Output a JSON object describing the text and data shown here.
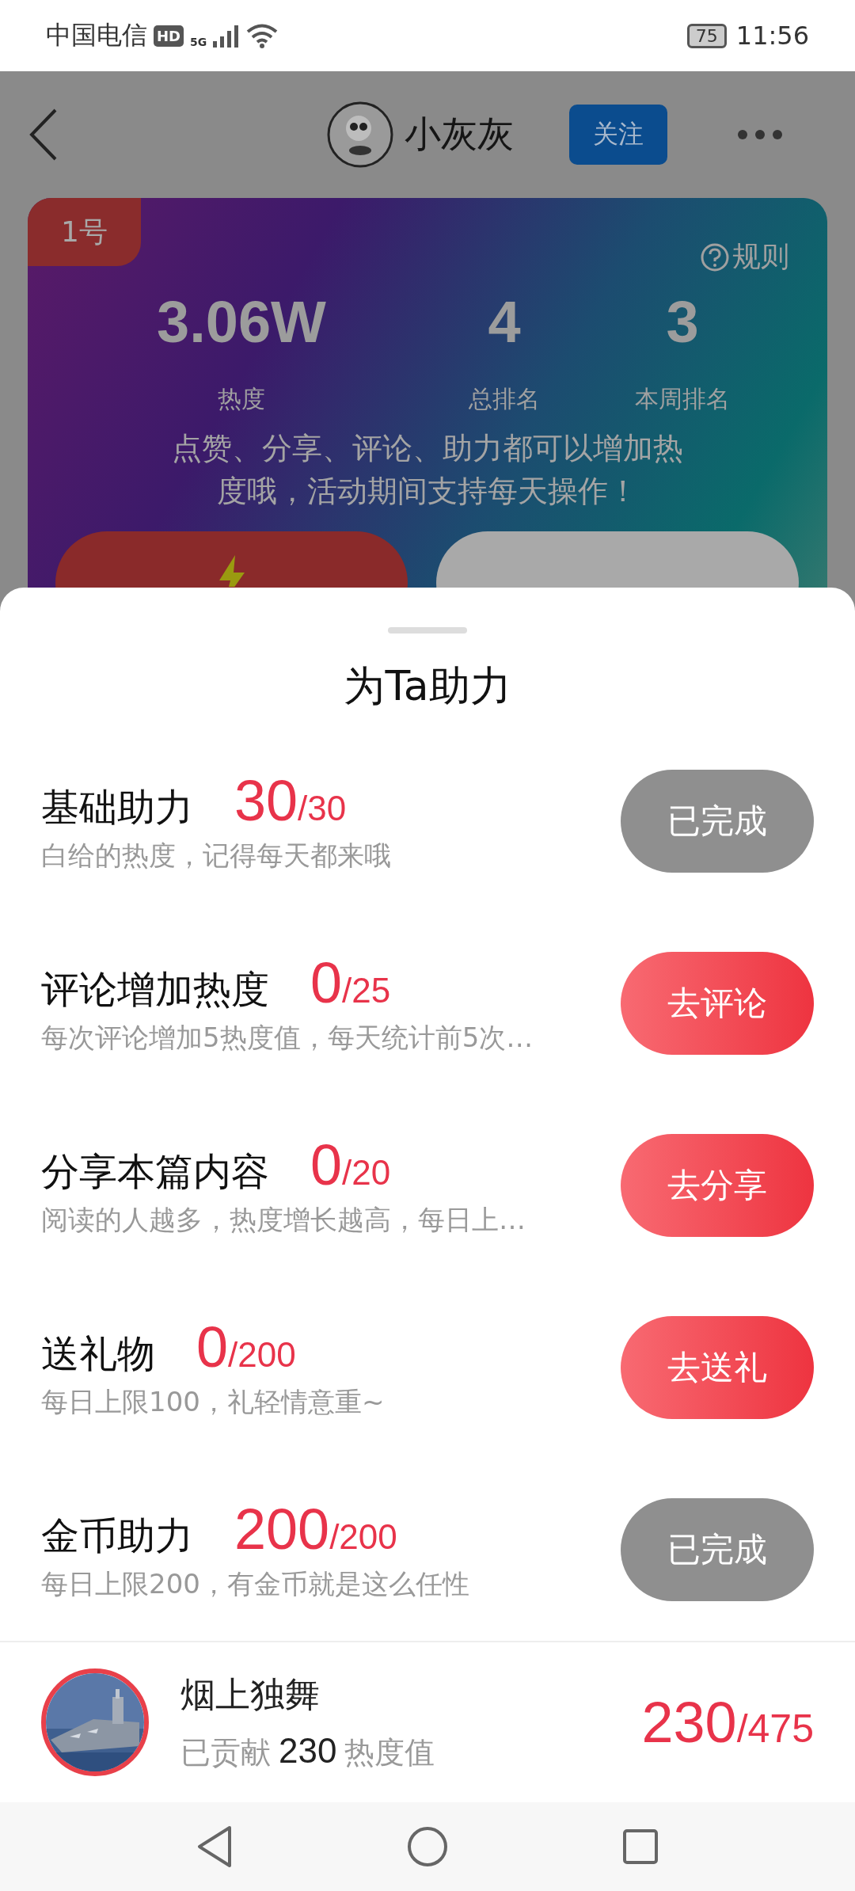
{
  "status_bar": {
    "carrier": "中国电信",
    "hd": "HD",
    "network": "5G",
    "battery": "75",
    "time": "11:56"
  },
  "header": {
    "username": "小灰灰",
    "follow_button": "关注"
  },
  "card": {
    "badge": "1号",
    "rules_link": "规则",
    "stats": [
      {
        "value": "3.06W",
        "label": "热度"
      },
      {
        "value": "4",
        "label": "总排名"
      },
      {
        "value": "3",
        "label": "本周排名"
      }
    ],
    "description": "点赞、分享、评论、助力都可以增加热度哦，活动期间支持每天操作！",
    "buttons": [
      {
        "kind": "boost"
      },
      {
        "kind": "join"
      }
    ]
  },
  "sheet": {
    "title": "为Ta助力",
    "tasks": [
      {
        "name": "基础助力",
        "current": "30",
        "total": "/30",
        "description": "白给的热度，记得每天都来哦",
        "button": "已完成",
        "completed": true
      },
      {
        "name": "评论增加热度",
        "current": "0",
        "total": "/25",
        "description": "每次评论增加5热度值，每天统计前5次…",
        "button": "去评论",
        "completed": false
      },
      {
        "name": "分享本篇内容",
        "current": "0",
        "total": "/20",
        "description": "阅读的人越多，热度增长越高，每日上…",
        "button": "去分享",
        "completed": false
      },
      {
        "name": "送礼物",
        "current": "0",
        "total": "/200",
        "description": "每日上限100，礼轻情意重~",
        "button": "去送礼",
        "completed": false
      },
      {
        "name": "金币助力",
        "current": "200",
        "total": "/200",
        "description": "每日上限200，有金币就是这么任性",
        "button": "已完成",
        "completed": true
      }
    ]
  },
  "contributor": {
    "name": "烟上独舞",
    "prefix": "已贡献",
    "amount": "230",
    "suffix": "热度值",
    "current": "230",
    "total": "/475"
  }
}
